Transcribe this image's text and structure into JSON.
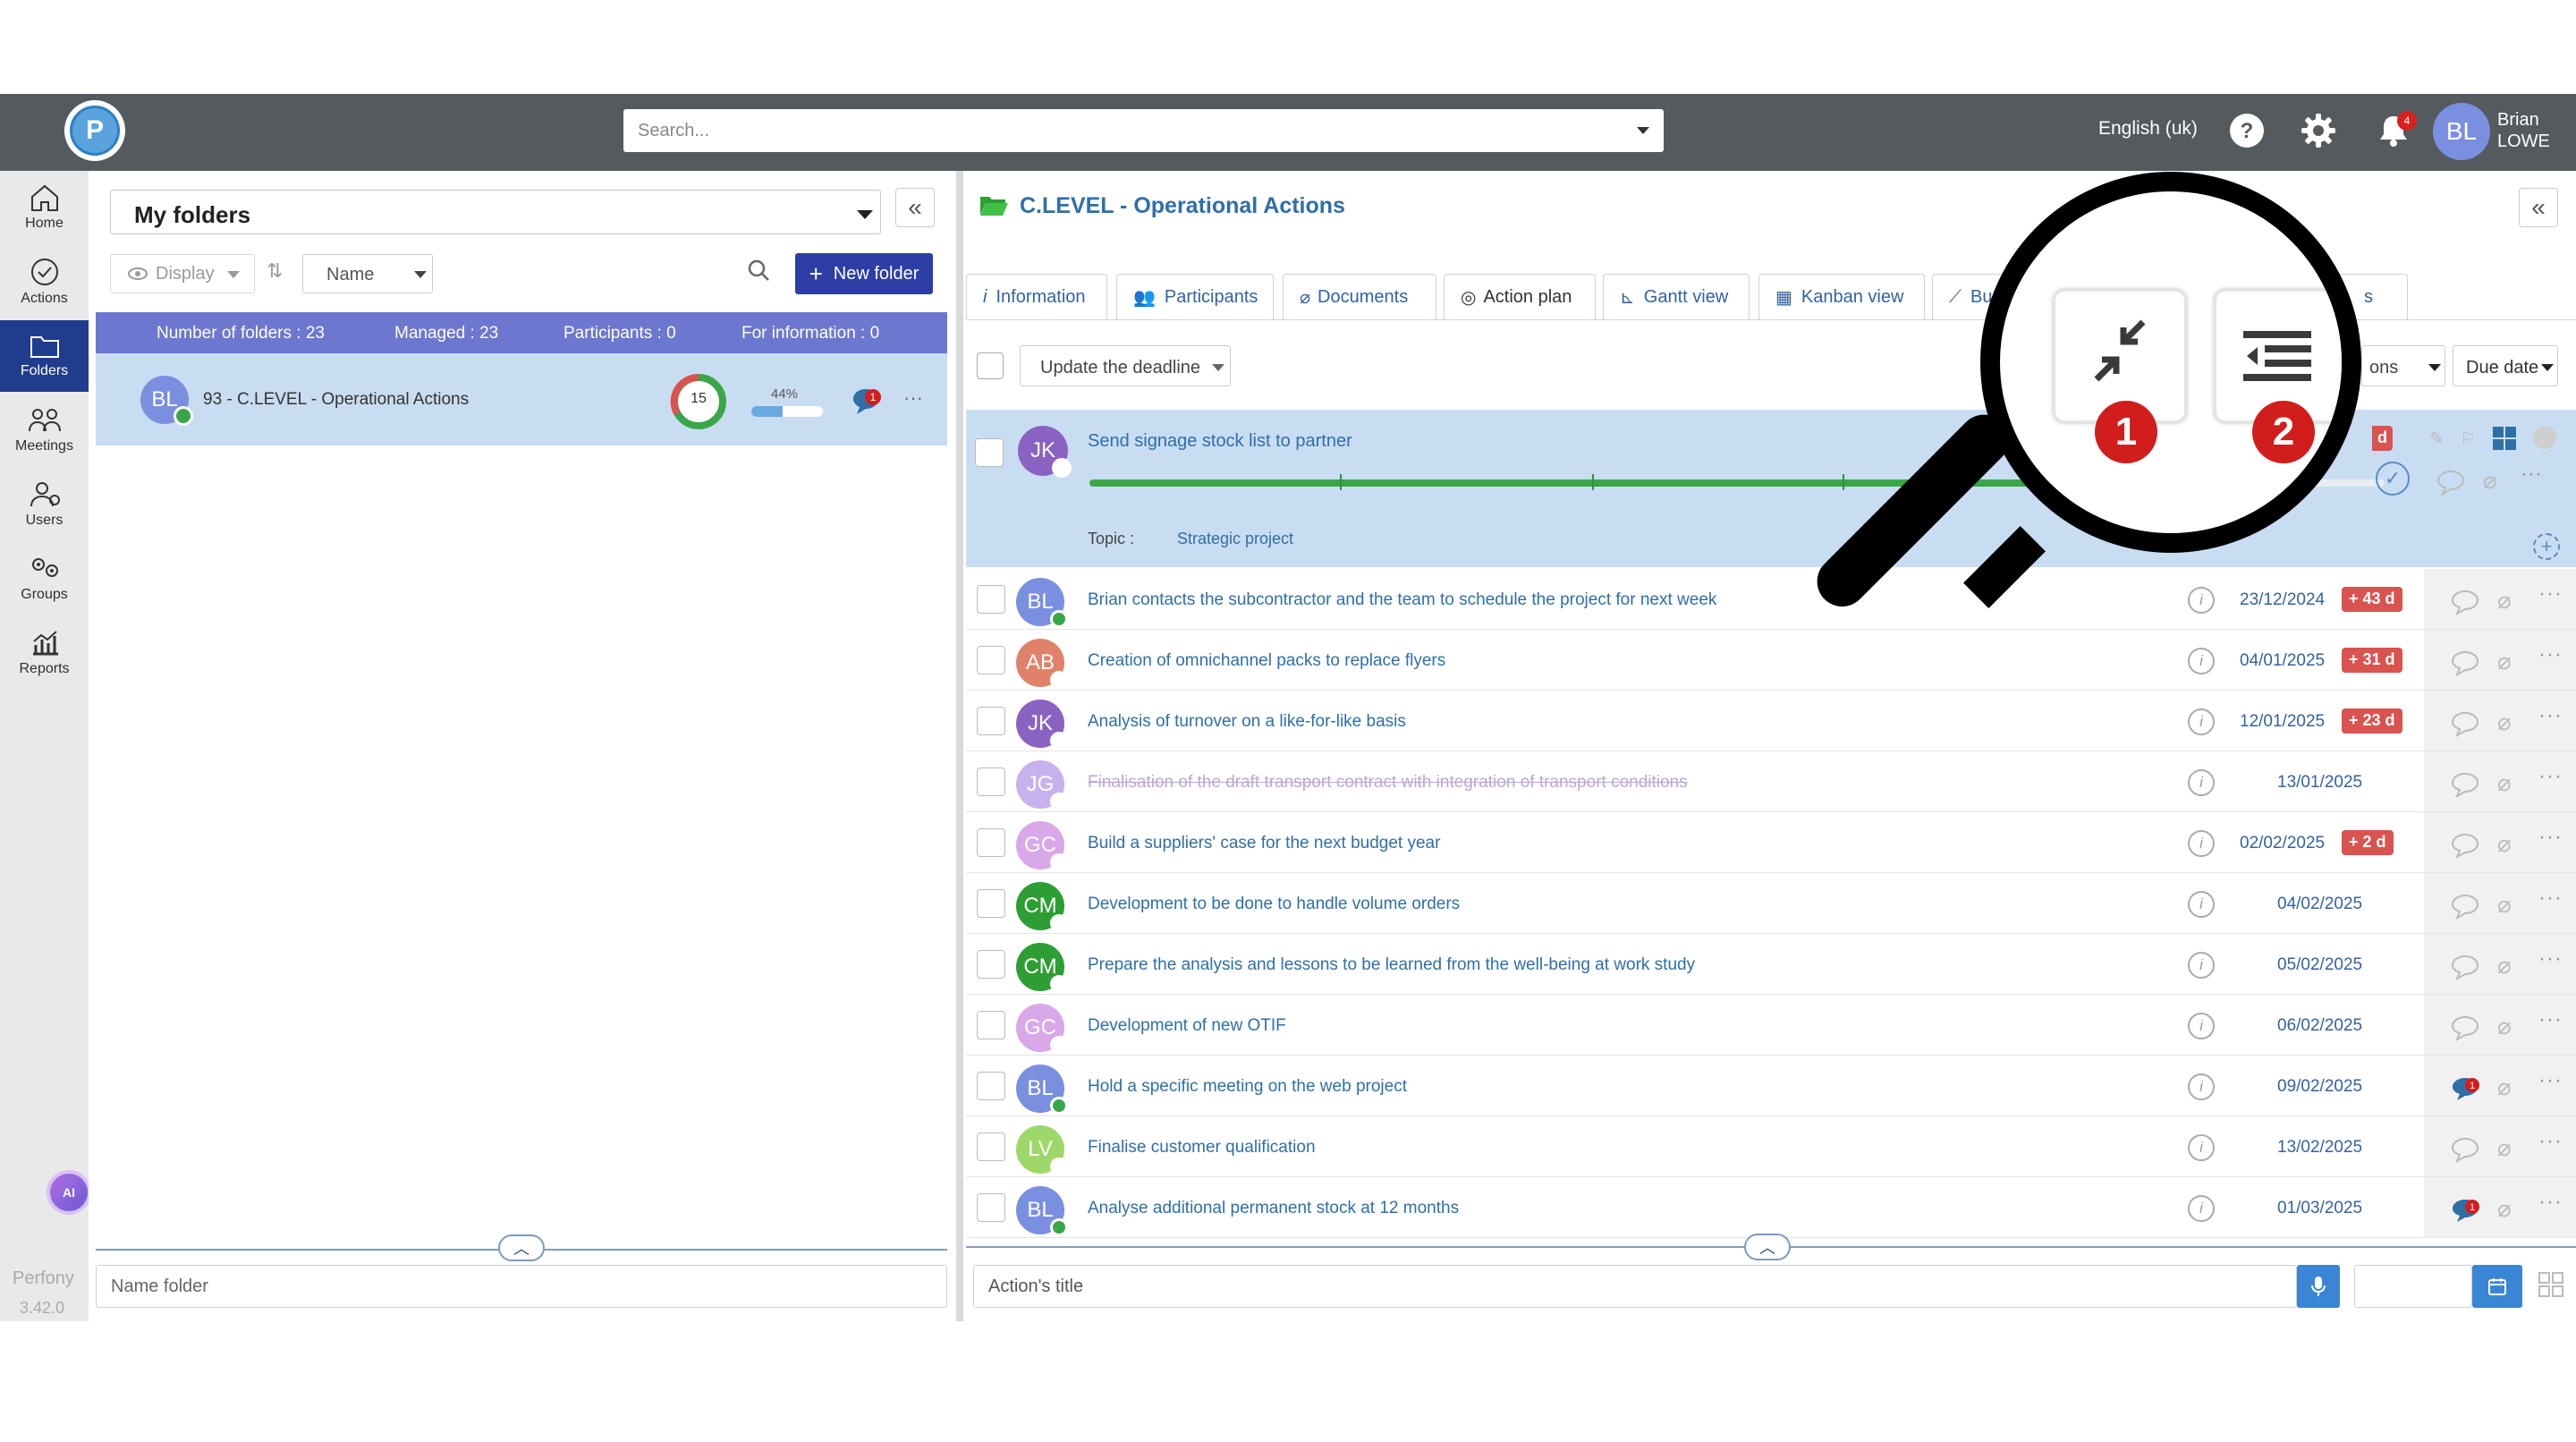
{
  "header": {
    "search_placeholder": "Search...",
    "language": "English (uk)",
    "notifications_count": "4",
    "user_initials": "BL",
    "user_first": "Brian",
    "user_last": "LOWE"
  },
  "nav": {
    "items": [
      {
        "label": "Home",
        "icon": "home-icon"
      },
      {
        "label": "Actions",
        "icon": "check-circle-icon"
      },
      {
        "label": "Folders",
        "icon": "folder-icon"
      },
      {
        "label": "Meetings",
        "icon": "meetings-icon"
      },
      {
        "label": "Users",
        "icon": "users-icon"
      },
      {
        "label": "Groups",
        "icon": "groups-icon"
      },
      {
        "label": "Reports",
        "icon": "reports-icon"
      }
    ],
    "active": "Folders",
    "ai_label": "AI",
    "brand": "Perfony",
    "version": "3.42.0"
  },
  "folders": {
    "selector": "My folders",
    "display_label": "Display",
    "sort_label": "Name",
    "new_folder_label": "New folder",
    "stats": {
      "count": "Number of folders : 23",
      "managed": "Managed : 23",
      "participants": "Participants : 0",
      "info": "For information : 0"
    },
    "row": {
      "initials": "BL",
      "title": "93 - C.LEVEL - Operational Actions",
      "actions_count": "15",
      "progress_label": "44%",
      "progress": 0.44,
      "comments": "1"
    },
    "name_placeholder": "Name folder"
  },
  "main": {
    "title": "C.LEVEL - Operational Actions",
    "tabs": [
      {
        "label": "Information",
        "icon": "info-icon"
      },
      {
        "label": "Participants",
        "icon": "participants-icon"
      },
      {
        "label": "Documents",
        "icon": "paperclip-icon"
      },
      {
        "label": "Action plan",
        "icon": "check-circle-icon"
      },
      {
        "label": "Gantt view",
        "icon": "gantt-icon"
      },
      {
        "label": "Kanban view",
        "icon": "kanban-icon"
      },
      {
        "label": "Bu",
        "icon": "chart-icon"
      },
      {
        "label": "s",
        "icon": ""
      }
    ],
    "active_tab": "Action plan",
    "deadline_label": "Update the deadline",
    "options_label": "ons",
    "sort_label": "Due date",
    "selected": {
      "initials": "JK",
      "title": "Send signage stock list to partner",
      "topic_label": "Topic :",
      "topic": "Strategic project",
      "late_partial": "d",
      "progress": 0.86
    },
    "rows": [
      {
        "initials": "BL",
        "color": "#7b8fe0",
        "status": "#3aa64a",
        "title": "Brian contacts the subcontractor and the team to schedule the project for next week",
        "date": "23/12/2024",
        "late": "+ 43 d",
        "done": false,
        "comments": ""
      },
      {
        "initials": "AB",
        "color": "#e0826a",
        "status": "#ffffff",
        "title": "Creation of omnichannel packs to replace flyers",
        "date": "04/01/2025",
        "late": "+ 31 d",
        "done": false,
        "comments": ""
      },
      {
        "initials": "JK",
        "color": "#8a63c2",
        "status": "#ffffff",
        "title": "Analysis of turnover on a like-for-like basis",
        "date": "12/01/2025",
        "late": "+ 23 d",
        "done": false,
        "comments": ""
      },
      {
        "initials": "JG",
        "color": "#c8b2ee",
        "status": "#ffffff",
        "title": "Finalisation of the draft transport contract with integration of transport conditions",
        "date": "13/01/2025",
        "late": "",
        "done": true,
        "comments": ""
      },
      {
        "initials": "GC",
        "color": "#d8a8e8",
        "status": "#ffffff",
        "title": "Build a suppliers' case for the next budget year",
        "date": "02/02/2025",
        "late": "+ 2 d",
        "done": false,
        "comments": ""
      },
      {
        "initials": "CM",
        "color": "#2e9e34",
        "status": "#ffffff",
        "title": "Development to be done to handle volume orders",
        "date": "04/02/2025",
        "late": "",
        "done": false,
        "comments": ""
      },
      {
        "initials": "CM",
        "color": "#2e9e34",
        "status": "#ffffff",
        "title": "Prepare the analysis and lessons to be learned from the well-being at work study",
        "date": "05/02/2025",
        "late": "",
        "done": false,
        "comments": ""
      },
      {
        "initials": "GC",
        "color": "#d8a8e8",
        "status": "#ffffff",
        "title": "Development of new OTIF",
        "date": "06/02/2025",
        "late": "",
        "done": false,
        "comments": ""
      },
      {
        "initials": "BL",
        "color": "#7b8fe0",
        "status": "#3aa64a",
        "title": "Hold a specific meeting on the web project",
        "date": "09/02/2025",
        "late": "",
        "done": false,
        "comments": "1"
      },
      {
        "initials": "LV",
        "color": "#9ed86a",
        "status": "#ffffff",
        "title": "Finalise customer qualification",
        "date": "13/02/2025",
        "late": "",
        "done": false,
        "comments": ""
      },
      {
        "initials": "BL",
        "color": "#7b8fe0",
        "status": "#3aa64a",
        "title": "Analyse additional permanent stock at 12 months",
        "date": "01/03/2025",
        "late": "",
        "done": false,
        "comments": "1"
      }
    ],
    "action_title_placeholder": "Action's title"
  },
  "magnifier": {
    "badge1": "1",
    "badge2": "2",
    "icon1": "collapse-arrows-icon",
    "icon2": "indent-list-icon"
  },
  "colors": {
    "topbar": "#555a5e",
    "accent": "#2d3fa5",
    "late": "#d9534f",
    "selected_row": "#c9ddf2"
  }
}
